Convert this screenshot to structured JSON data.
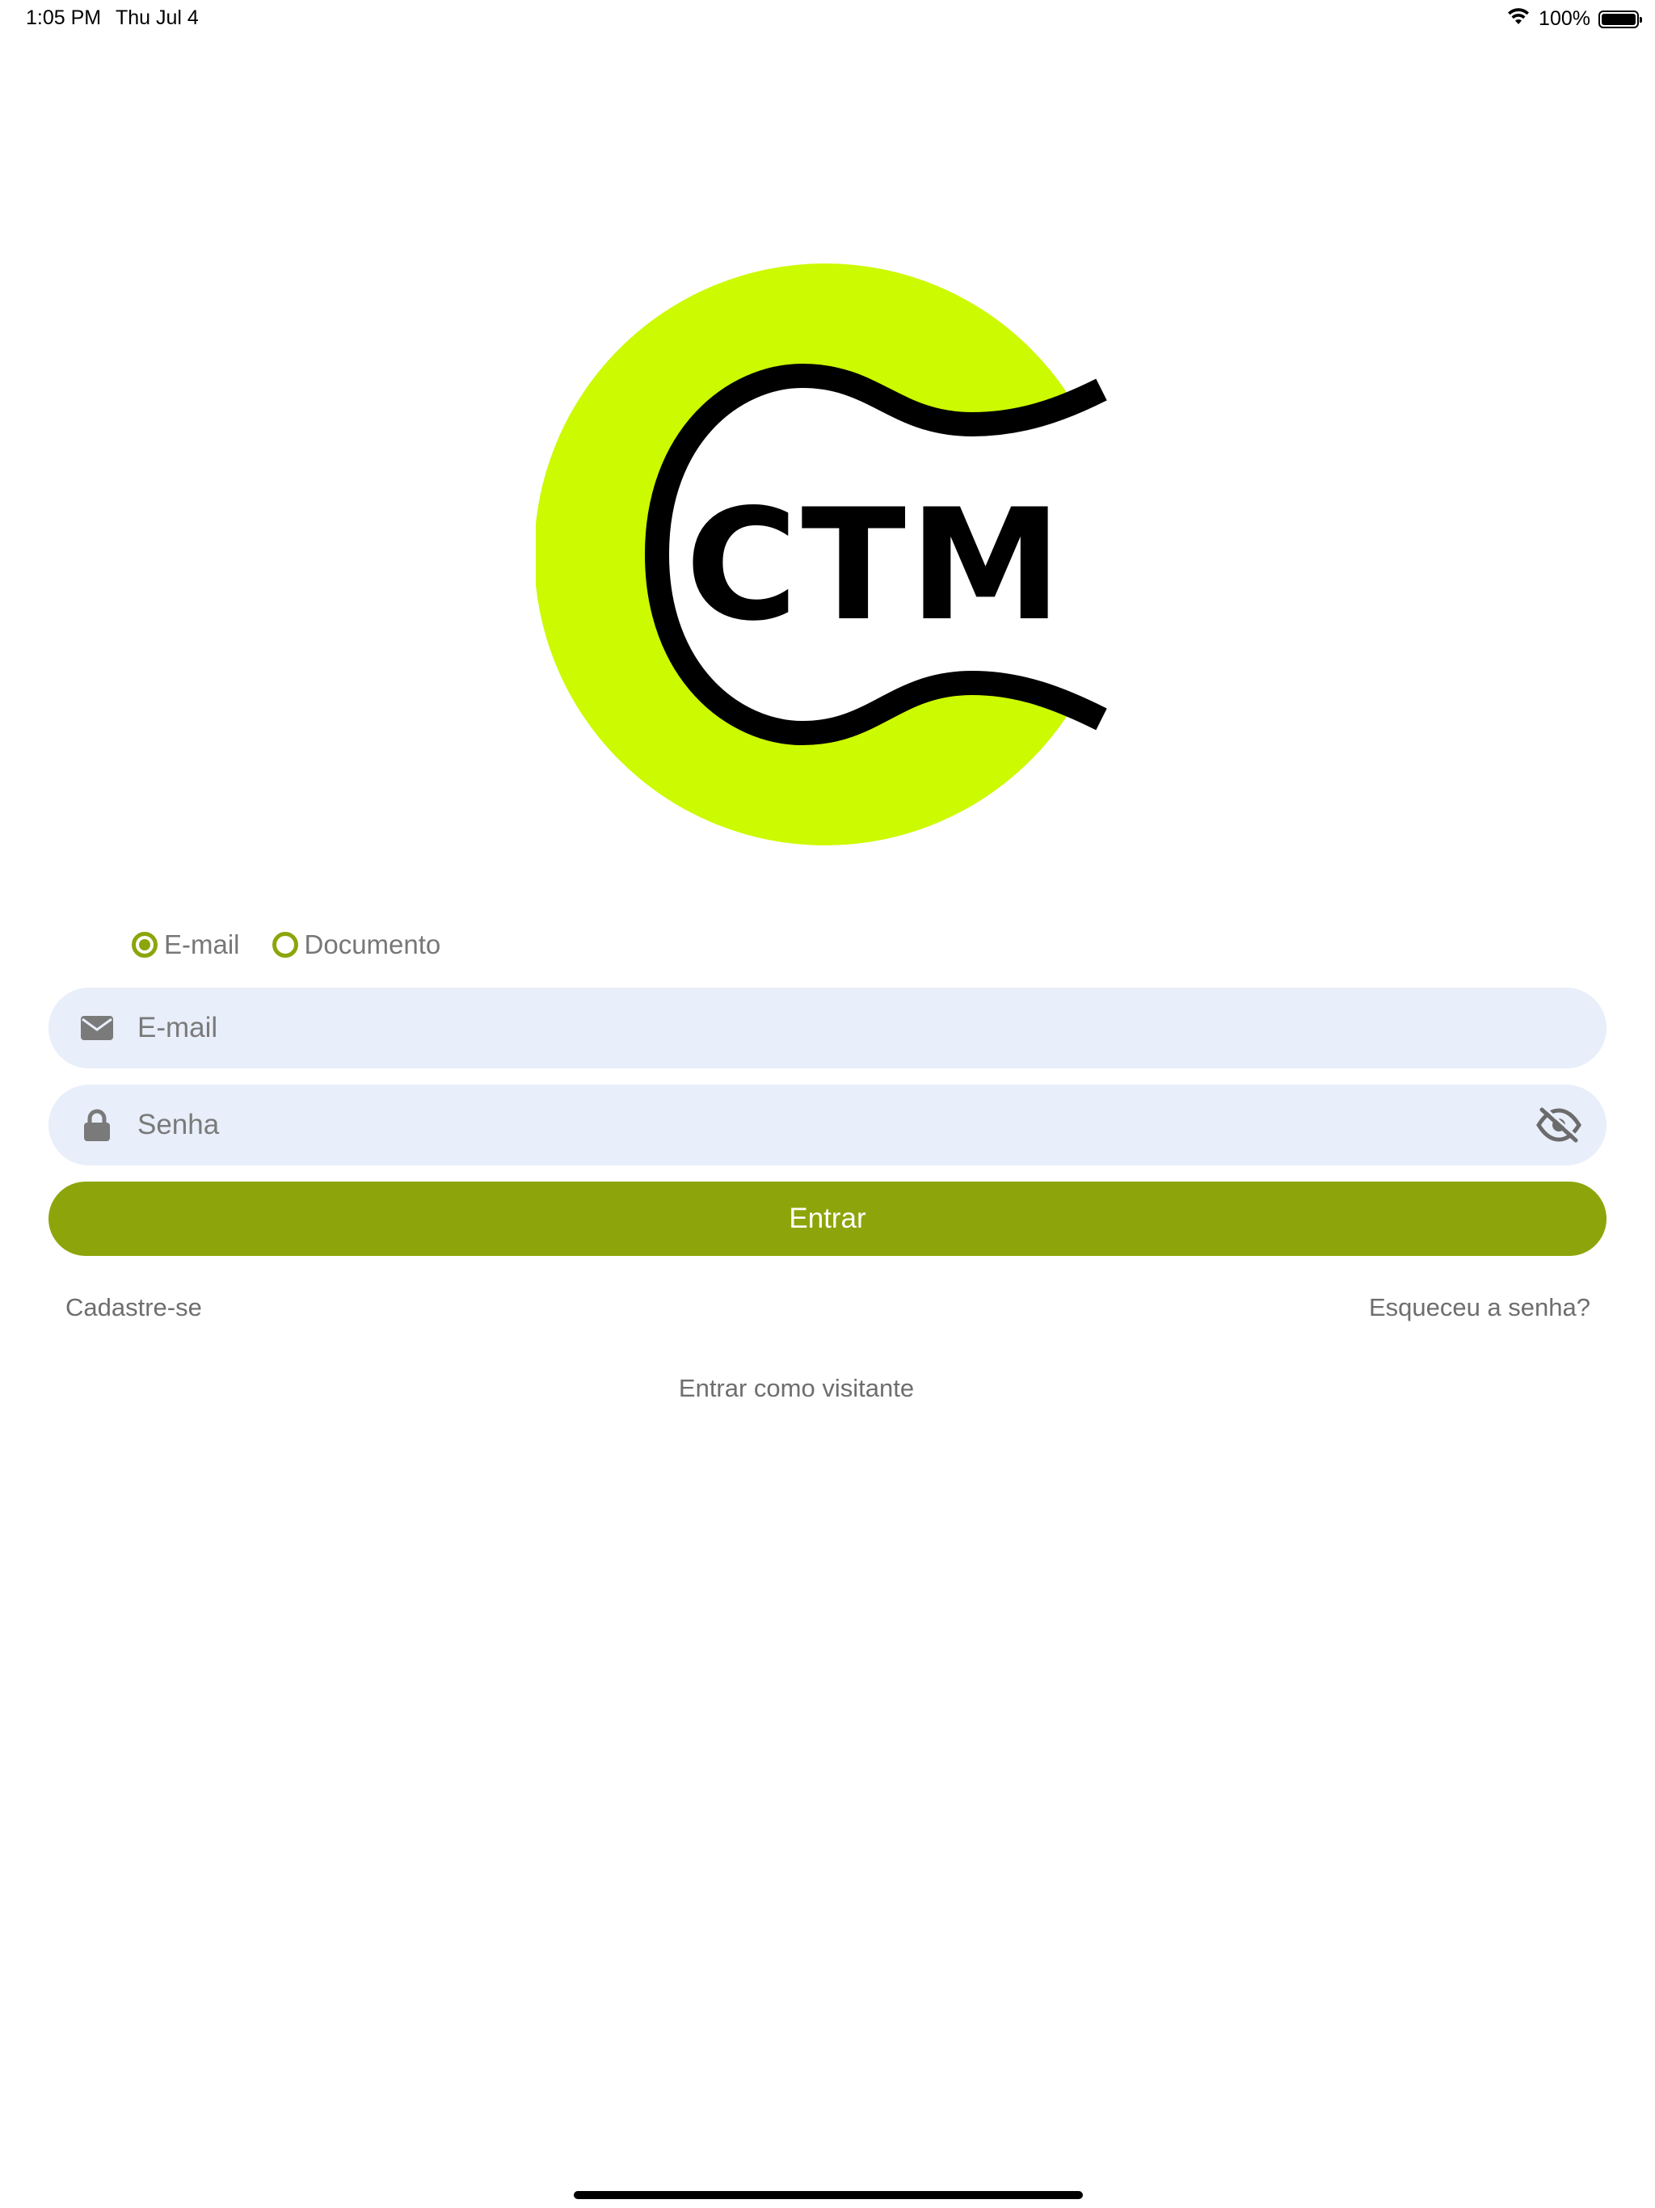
{
  "status_bar": {
    "time": "1:05 PM",
    "date": "Thu Jul 4",
    "battery_percent": "100%"
  },
  "logo": {
    "text": "CTM",
    "circle_color": "#ccfa00",
    "stroke_color": "#000000"
  },
  "login_type": {
    "options": [
      {
        "label": "E-mail",
        "selected": true
      },
      {
        "label": "Documento",
        "selected": false
      }
    ]
  },
  "form": {
    "email_placeholder": "E-mail",
    "password_placeholder": "Senha",
    "submit_label": "Entrar"
  },
  "links": {
    "signup": "Cadastre-se",
    "forgot_password": "Esqueceu a senha?",
    "guest": "Entrar como visitante"
  },
  "colors": {
    "accent": "#8da50a",
    "input_bg": "#e8eefa",
    "muted_text": "#777777"
  },
  "icons": {
    "email": "envelope-icon",
    "password": "lock-icon",
    "visibility": "eye-slash-icon"
  }
}
